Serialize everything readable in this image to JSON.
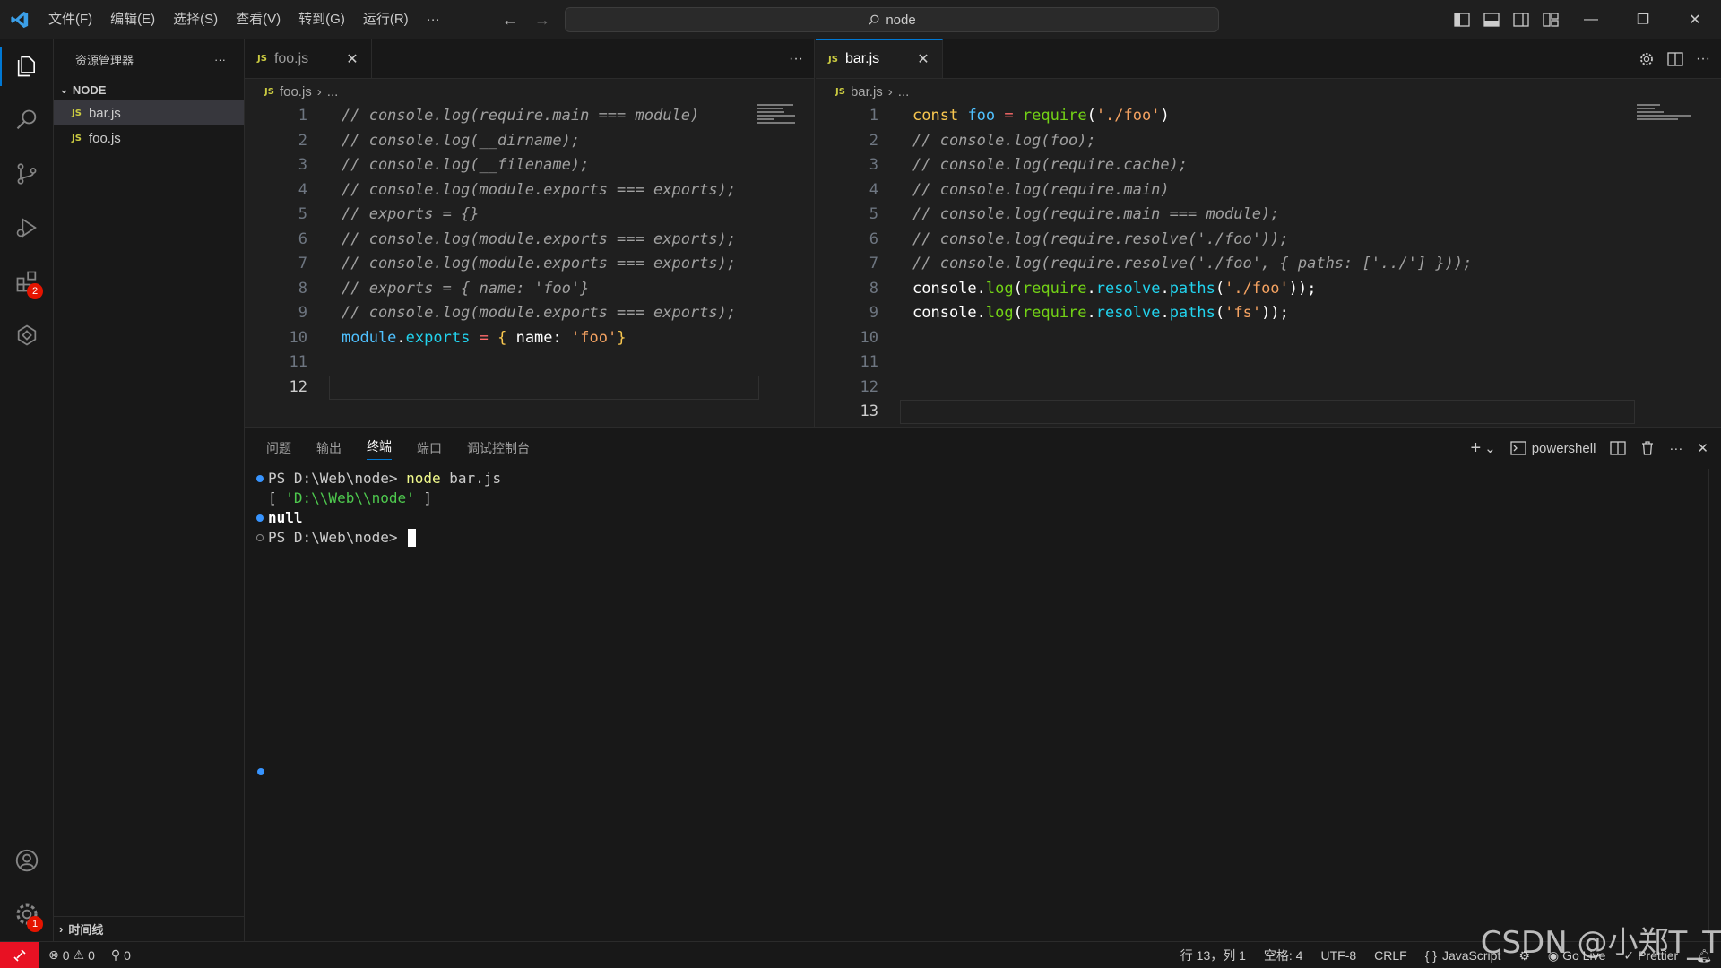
{
  "titlebar": {
    "menu": [
      "文件(F)",
      "编辑(E)",
      "选择(S)",
      "查看(V)",
      "转到(G)",
      "运行(R)",
      "···"
    ],
    "search_text": "node"
  },
  "activity": {
    "extensions_badge": "2",
    "settings_badge": "1"
  },
  "sidebar": {
    "title": "资源管理器",
    "folder": "NODE",
    "files": [
      "bar.js",
      "foo.js"
    ],
    "timeline": "时间线"
  },
  "editor_left": {
    "tab": "foo.js",
    "breadcrumb_file": "foo.js",
    "breadcrumb_more": "...",
    "current_line": 12,
    "lines": [
      "// console.log(require.main === module)",
      "// console.log(__dirname);",
      "// console.log(__filename);",
      "// console.log(module.exports === exports);",
      "// exports = {}",
      "// console.log(module.exports === exports);",
      "// console.log(module.exports === exports);",
      "// exports = { name: 'foo'}",
      "// console.log(module.exports === exports);",
      "module.exports = { name: 'foo'}",
      "",
      ""
    ]
  },
  "editor_right": {
    "tab": "bar.js",
    "breadcrumb_file": "bar.js",
    "breadcrumb_more": "...",
    "current_line": 13,
    "lines": [
      "const foo = require('./foo')",
      "// console.log(foo);",
      "// console.log(require.cache);",
      "// console.log(require.main)",
      "// console.log(require.main === module);",
      "// console.log(require.resolve('./foo'));",
      "// console.log(require.resolve('./foo', { paths: ['../'] }));",
      "console.log(require.resolve.paths('./foo'));",
      "console.log(require.resolve.paths('fs'));",
      "",
      "",
      "",
      ""
    ]
  },
  "panel": {
    "tabs": [
      "问题",
      "输出",
      "终端",
      "端口",
      "调试控制台"
    ],
    "active_tab": "终端",
    "shell": "powershell",
    "terminal": [
      {
        "dot": "blue",
        "prompt": "PS D:\\Web\\node> ",
        "cmd": "node",
        "rest": " bar.js"
      },
      {
        "dot": "none",
        "text_open": "[ ",
        "str": "'D:\\\\Web\\\\node'",
        "text_close": " ]"
      },
      {
        "dot": "blue",
        "bold": "null"
      },
      {
        "dot": "hollow",
        "prompt": "PS D:\\Web\\node> "
      }
    ]
  },
  "statusbar": {
    "errors": "0",
    "warnings": "0",
    "ports": "0",
    "position": "行 13，列 1",
    "spaces": "空格: 4",
    "encoding": "UTF-8",
    "eol": "CRLF",
    "language": "JavaScript",
    "golive": "Go Live",
    "prettier": "Prettier"
  },
  "watermark": "CSDN @小郑T_T",
  "colors": {
    "accent": "#0078d4",
    "error": "#e51400",
    "remote": "#e81123"
  }
}
